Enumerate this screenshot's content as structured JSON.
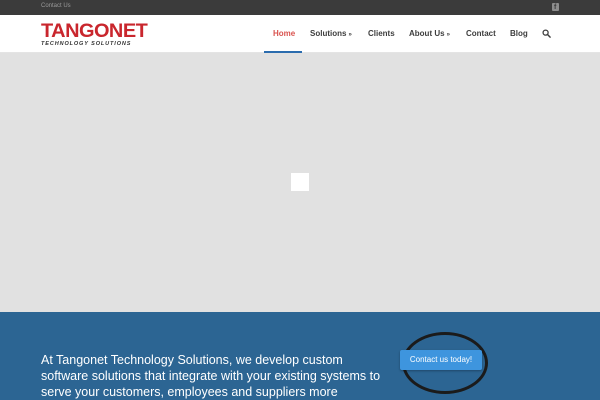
{
  "topbar": {
    "contact_link": "Contact Us",
    "facebook_icon": "facebook-icon"
  },
  "logo": {
    "brand": "TANGONET",
    "tagline": "TECHNOLOGY SOLUTIONS"
  },
  "nav": {
    "items": [
      {
        "label": "Home",
        "active": true
      },
      {
        "label": "Solutions",
        "dropdown": true
      },
      {
        "label": "Clients"
      },
      {
        "label": "About Us",
        "dropdown": true
      },
      {
        "label": "Contact"
      },
      {
        "label": "Blog"
      }
    ],
    "dropdown_glyph": "»",
    "search_icon": "search-icon"
  },
  "cta": {
    "text": "At Tangonet Technology Solutions, we develop custom software solutions that integrate with your existing systems to serve your customers, employees and suppliers more effectively and",
    "button_label": "Contact us today!"
  },
  "colors": {
    "topbar_bg": "#3b3b3b",
    "brand_red": "#c9262d",
    "nav_active": "#d9534f",
    "nav_underline": "#2b6cae",
    "hero_bg": "#e1e1e1",
    "cta_bg": "#2c6593",
    "cta_button": "#3e95de"
  }
}
